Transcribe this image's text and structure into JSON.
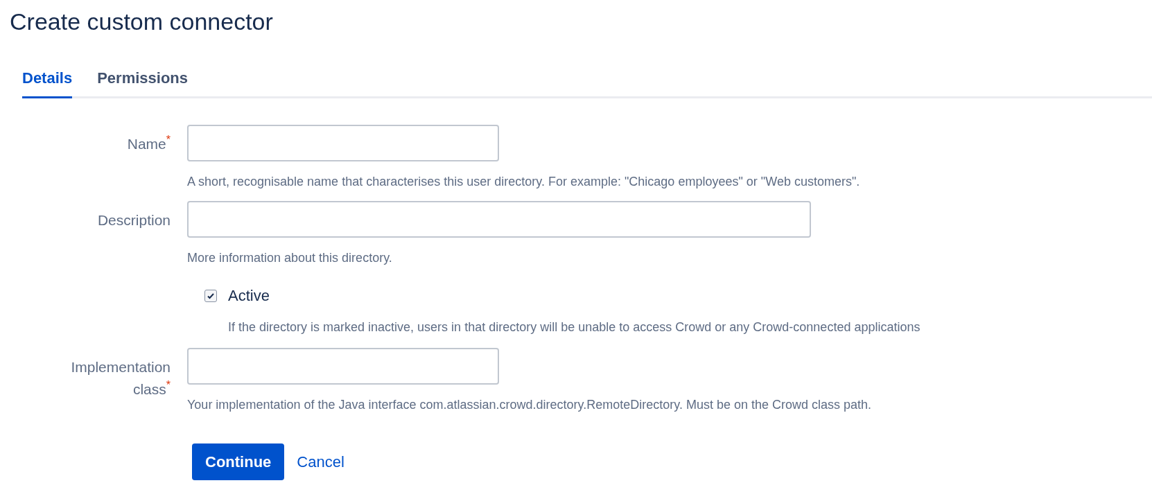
{
  "title": "Create custom connector",
  "tabs": [
    {
      "label": "Details",
      "selected": true
    },
    {
      "label": "Permissions",
      "selected": false
    }
  ],
  "fields": [
    {
      "kind": "text",
      "label": "Name",
      "required_mark": "*",
      "help": "A short, recognisable name that characterises this user directory. For example: \"Chicago employees\" or \"Web customers\"."
    },
    {
      "kind": "text",
      "label": "Description",
      "help": "More information about this directory."
    },
    {
      "kind": "checkbox",
      "label": "Active",
      "checked": true,
      "help": "If the directory is marked inactive, users in that directory will be unable to access Crowd or any Crowd-connected applications"
    },
    {
      "kind": "text",
      "label": "Implementation class",
      "required_mark": "*",
      "help": "Your implementation of the Java interface com.atlassian.crowd.directory.RemoteDirectory. Must be on the Crowd class path."
    }
  ],
  "actions": {
    "primary": "Continue",
    "secondary": "Cancel"
  }
}
